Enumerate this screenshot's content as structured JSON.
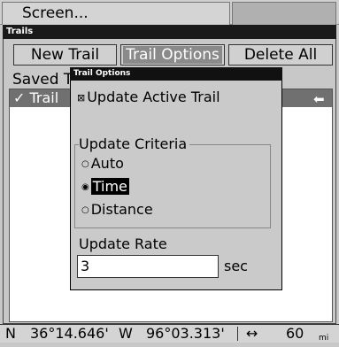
{
  "menu": {
    "screen_label": "Screen..."
  },
  "trails_window": {
    "title": "Trails",
    "buttons": {
      "new_trail": "New Trail",
      "trail_options": "Trail Options",
      "delete_all": "Delete All"
    },
    "saved_label": "Saved T",
    "trail_item": "✓ Trail",
    "trail_item_icon": "arrow-left-icon"
  },
  "dialog": {
    "title": "Trail Options",
    "update_active": {
      "checkbox": "⊠",
      "label": "Update Active Trail",
      "checked": true
    },
    "criteria": {
      "legend": "Update Criteria",
      "options": [
        "Auto",
        "Time",
        "Distance"
      ],
      "selected": "Time"
    },
    "rate": {
      "label": "Update Rate",
      "value": "3",
      "unit": "sec"
    }
  },
  "status_bar": {
    "lat_hemisphere": "N",
    "lat": "36°14.646'",
    "lon_hemisphere": "W",
    "lon": "96°03.313'",
    "range_icon": "↔",
    "range_value": "60",
    "range_unit": "mi"
  }
}
